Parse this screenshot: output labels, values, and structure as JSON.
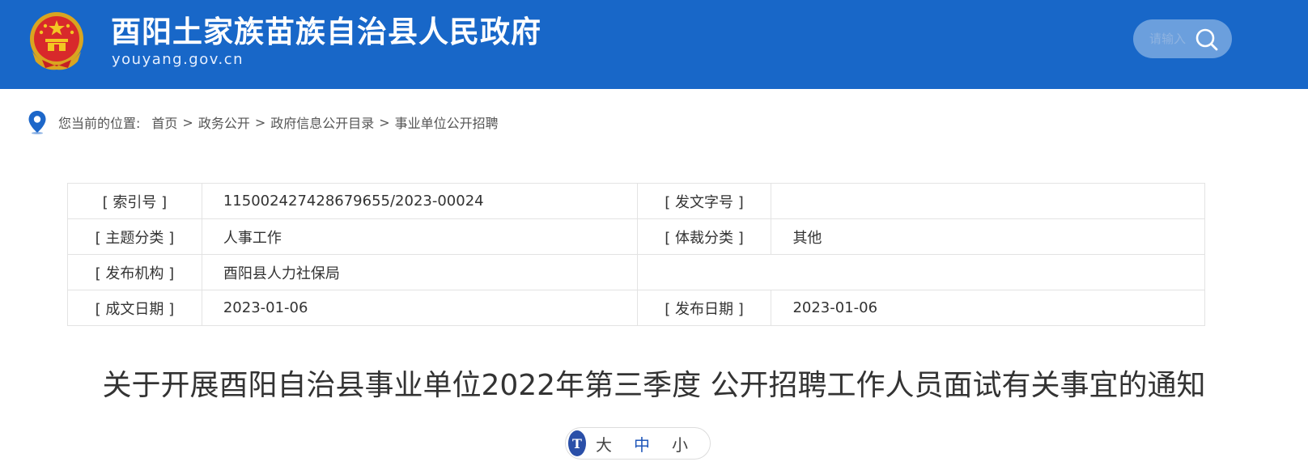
{
  "header": {
    "site_title": "酉阳土家族苗族自治县人民政府",
    "site_domain": "youyang.gov.cn",
    "emblem_icon": "national-emblem-icon",
    "search": {
      "placeholder": "请输入",
      "icon": "search-icon"
    },
    "colors": {
      "background": "#1867c8",
      "search_bg": "#6b9fdd"
    }
  },
  "breadcrumb": {
    "icon": "location-pin-icon",
    "label": "您当前的位置:",
    "items": [
      "首页",
      "政务公开",
      "政府信息公开目录",
      "事业单位公开招聘"
    ],
    "separator": ">"
  },
  "meta": {
    "index_label": "[ 索引号 ]",
    "index_value": "115002427428679655/2023-00024",
    "doc_no_label": "[ 发文字号 ]",
    "doc_no_value": "",
    "topic_label": "[ 主题分类 ]",
    "topic_value": "人事工作",
    "genre_label": "[ 体裁分类 ]",
    "genre_value": "其他",
    "publisher_label": "[ 发布机构 ]",
    "publisher_value": "酉阳县人力社保局",
    "created_label": "[ 成文日期 ]",
    "created_value": "2023-01-06",
    "published_label": "[ 发布日期 ]",
    "published_value": "2023-01-06"
  },
  "article": {
    "title": "关于开展酉阳自治县事业单位2022年第三季度 公开招聘工作人员面试有关事宜的通知"
  },
  "font_size": {
    "icon": "text-size-icon",
    "icon_text": "T",
    "large": "大",
    "medium": "中",
    "small": "小",
    "selected": "中",
    "accent": "#1f56b9"
  }
}
